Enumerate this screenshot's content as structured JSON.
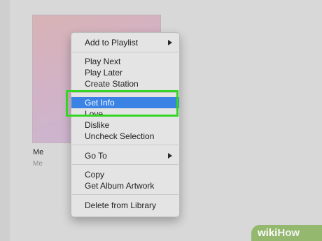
{
  "album": {
    "title": "Me",
    "artist": "Me"
  },
  "context_menu": {
    "items": [
      {
        "label": "Add to Playlist",
        "submenu": true
      },
      {
        "label": "Play Next"
      },
      {
        "label": "Play Later"
      },
      {
        "label": "Create Station"
      },
      {
        "label": "Get Info",
        "highlighted": true
      },
      {
        "label": "Love"
      },
      {
        "label": "Dislike"
      },
      {
        "label": "Uncheck Selection"
      },
      {
        "label": "Go To",
        "submenu": true
      },
      {
        "label": "Copy"
      },
      {
        "label": "Get Album Artwork"
      },
      {
        "label": "Delete from Library"
      }
    ]
  },
  "watermark": {
    "wiki": "wiki",
    "how": "How"
  },
  "colors": {
    "highlight": "#3a83e4",
    "annotation_box": "#35d623",
    "watermark_bg": "#93b86e"
  }
}
